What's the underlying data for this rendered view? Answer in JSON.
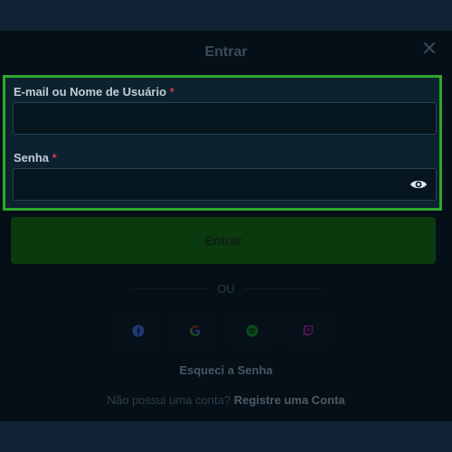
{
  "modal": {
    "title": "Entrar",
    "close_icon": "close-icon"
  },
  "form": {
    "email_label": "E-mail ou Nome de Usuário",
    "password_label": "Senha",
    "required_marker": "*",
    "email_value": "",
    "password_value": "",
    "password_toggle_icon": "eye-icon",
    "submit_label": "Entrar"
  },
  "alt_login": {
    "divider_text": "OU",
    "providers": [
      {
        "name": "facebook",
        "icon": "facebook-icon",
        "color": "#1f3a78"
      },
      {
        "name": "google",
        "icon": "google-icon",
        "color": "#3a3a1a"
      },
      {
        "name": "spotify",
        "icon": "spotify-icon",
        "color": "#0c4a1e"
      },
      {
        "name": "twitch",
        "icon": "twitch-icon",
        "color": "#4a1a5a"
      }
    ]
  },
  "links": {
    "forgot_password": "Esqueci a Senha",
    "no_account_text": "Não possui uma conta?",
    "register_link": "Registre uma Conta"
  },
  "colors": {
    "highlight_border": "#2ea82e",
    "submit_bg": "#0a3a0e",
    "required": "#d03a4e"
  }
}
